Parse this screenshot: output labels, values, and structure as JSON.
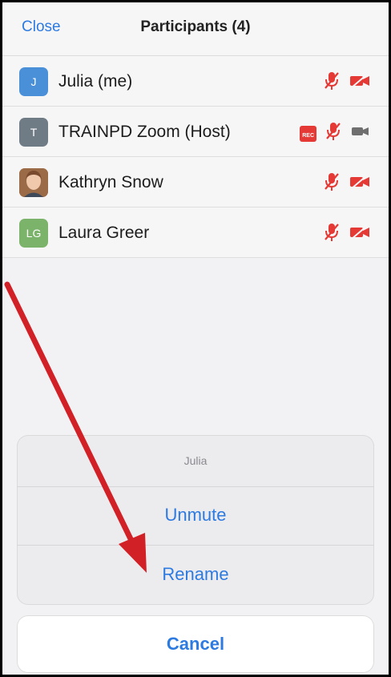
{
  "header": {
    "close_label": "Close",
    "title": "Participants (4)"
  },
  "participants": [
    {
      "initials": "J",
      "name": "Julia  (me)",
      "avatar_color": "#4a90d9",
      "mic": "muted",
      "video": "off",
      "rec": ""
    },
    {
      "initials": "T",
      "name": "TRAINPD Zoom (Host)",
      "avatar_color": "#6f7b85",
      "mic": "muted",
      "video": "on",
      "rec": "REC"
    },
    {
      "initials": "",
      "name": "Kathryn Snow",
      "avatar_color": "#b27a55",
      "mic": "muted",
      "video": "off",
      "rec": ""
    },
    {
      "initials": "LG",
      "name": "Laura Greer",
      "avatar_color": "#7cb36a",
      "mic": "muted",
      "video": "off",
      "rec": ""
    }
  ],
  "action_sheet": {
    "title": "Julia",
    "actions": [
      "Unmute",
      "Rename"
    ],
    "cancel_label": "Cancel"
  },
  "colors": {
    "accent": "#2d7ae0",
    "muted_red": "#e53935",
    "annotation_arrow": "#d22027"
  },
  "icons": {
    "mic_muted": "mic-muted-icon",
    "video_off": "video-off-icon",
    "video_on": "video-icon",
    "recording": "recording-badge"
  }
}
